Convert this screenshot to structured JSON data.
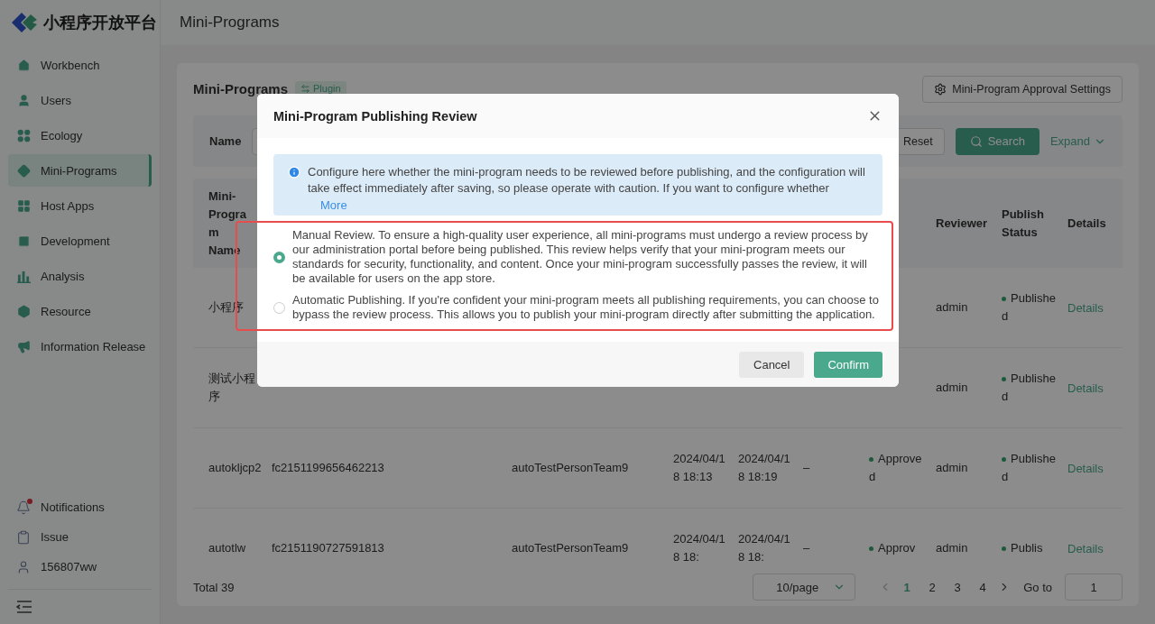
{
  "brand": {
    "name": "小程序开放平台"
  },
  "sidebar": {
    "items": [
      {
        "label": "Workbench",
        "selected": false
      },
      {
        "label": "Users",
        "selected": false
      },
      {
        "label": "Ecology",
        "selected": false
      },
      {
        "label": "Mini-Programs",
        "selected": true
      },
      {
        "label": "Host Apps",
        "selected": false
      },
      {
        "label": "Development",
        "selected": false
      },
      {
        "label": "Analysis",
        "selected": false
      },
      {
        "label": "Resource",
        "selected": false
      },
      {
        "label": "Information Release",
        "selected": false
      }
    ],
    "footer_items": [
      {
        "label": "Notifications",
        "badge": true
      },
      {
        "label": "Issue",
        "badge": false
      },
      {
        "label": "156807ww",
        "badge": false
      }
    ]
  },
  "header": {
    "title": "Mini-Programs"
  },
  "card": {
    "title": "Mini-Programs",
    "tag": "Plugin",
    "settings_button": "Mini-Program Approval Settings"
  },
  "filter": {
    "label": "Name",
    "reset": "Reset",
    "search": "Search",
    "expand": "Expand"
  },
  "table": {
    "headers": {
      "name": "Mini-Program Name",
      "reviewer": "Reviewer",
      "publish_status": "Publish Status",
      "details": "Details"
    },
    "rows": [
      {
        "name": "小程序",
        "reviewer": "admin",
        "publish_status": "Published",
        "details": "Details"
      },
      {
        "name": "测试小程序",
        "reviewer": "admin",
        "publish_status": "Published",
        "details": "Details"
      },
      {
        "name": "autokljcp2",
        "column_2": "fc2151199656462213",
        "column_3": "autoTestPersonTeam9",
        "column_4": "2024/04/18 18:13",
        "column_5": "2024/04/18 18:19",
        "column_6": "–",
        "approval": "Approved",
        "reviewer": "admin",
        "publish_status": "Published",
        "details": "Details"
      },
      {
        "name": "autotlw",
        "column_2": "fc2151190727591813",
        "column_3": "autoTestPersonTeam9",
        "column_4": "2024/04/18 18:",
        "column_5": "2024/04/18 18:",
        "column_6": "–",
        "approval": "Approv",
        "reviewer": "admin",
        "publish_status": "Publis",
        "details": "Details"
      }
    ]
  },
  "pagination": {
    "total": "Total 39",
    "page_size": "10/page",
    "pages": [
      {
        "label": "1",
        "selected": true
      },
      {
        "label": "2",
        "selected": false
      },
      {
        "label": "3",
        "selected": false
      },
      {
        "label": "4",
        "selected": false
      }
    ],
    "goto_label": "Go to",
    "goto_value": "1"
  },
  "dialog": {
    "title": "Mini-Program Publishing Review",
    "notice": "Configure here whether the mini-program needs to be reviewed before publishing, and the configuration will take effect immediately after saving, so please operate with caution. If you want to configure whether",
    "more_link": "More",
    "options": [
      {
        "label": "Manual Review. To ensure a high-quality user experience, all mini-programs must undergo a review process by our administration portal before being published. This review helps verify that your mini-program meets our standards for security, functionality, and content. Once your mini-program successfully passes the review, it will be available for users on the app store.",
        "selected": true
      },
      {
        "label": "Automatic Publishing. If you're confident your mini-program meets all publishing requirements, you can choose to bypass the review process. This allows you to publish your mini-program directly after submitting the application.",
        "selected": false
      }
    ],
    "cancel": "Cancel",
    "confirm": "Confirm"
  }
}
